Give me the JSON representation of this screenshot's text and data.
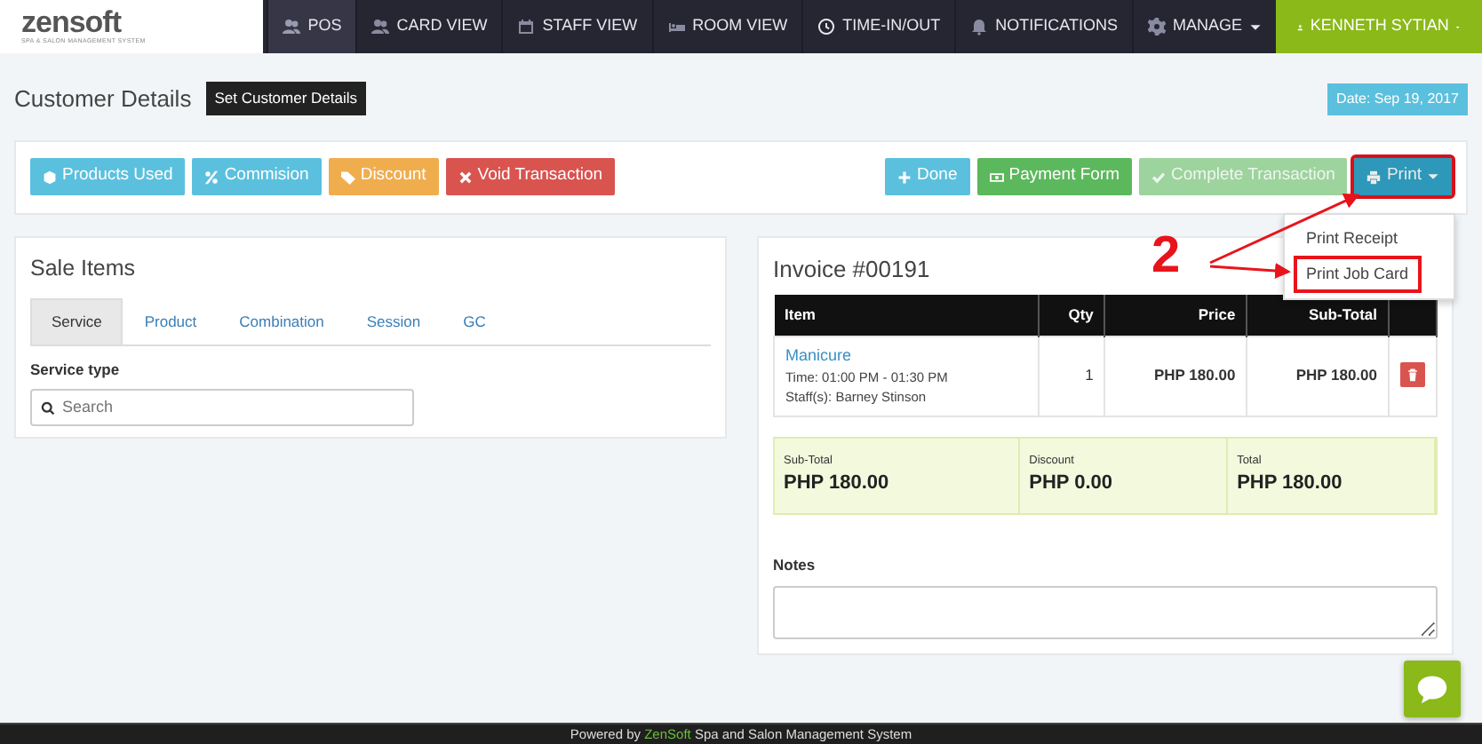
{
  "brand": {
    "name": "zensoft",
    "tagline": "SPA & SALON MANAGEMENT SYSTEM"
  },
  "nav": [
    {
      "label": "POS",
      "selected": true
    },
    {
      "label": "CARD VIEW",
      "selected": false
    },
    {
      "label": "STAFF VIEW",
      "selected": false
    },
    {
      "label": "ROOM VIEW",
      "selected": false
    },
    {
      "label": "TIME-IN/OUT",
      "selected": false
    },
    {
      "label": "NOTIFICATIONS",
      "selected": false
    },
    {
      "label": "MANAGE",
      "selected": false,
      "dropdown": true
    }
  ],
  "user": {
    "label": "KENNETH SYTIAN"
  },
  "page": {
    "title": "Customer Details",
    "action": "Set Customer Details",
    "date": "Date: Sep 19, 2017"
  },
  "left_buttons": [
    {
      "label": "Products Used",
      "color": "#5bc0de"
    },
    {
      "label": "Commision",
      "color": "#5bc0de"
    },
    {
      "label": "Discount",
      "color": "#f0ad4e"
    },
    {
      "label": "Void Transaction",
      "color": "#d9534f"
    }
  ],
  "right_buttons": [
    {
      "label": "Done",
      "color": "#5bc0de",
      "disabled": false
    },
    {
      "label": "Payment Form",
      "color": "#5cb85c",
      "disabled": false
    },
    {
      "label": "Complete Transaction",
      "color": "#9dd39d",
      "disabled": true
    }
  ],
  "print": {
    "label": "Print",
    "highlighted": true,
    "expanded": true,
    "menu": [
      {
        "label": "Print Receipt",
        "highlighted": false
      },
      {
        "label": "Print Job Card",
        "highlighted": true
      }
    ]
  },
  "annotation": {
    "label": "2"
  },
  "sale_items": {
    "title": "Sale Items",
    "tabs": [
      {
        "label": "Service",
        "selected": true
      },
      {
        "label": "Product",
        "selected": false
      },
      {
        "label": "Combination",
        "selected": false
      },
      {
        "label": "Session",
        "selected": false
      },
      {
        "label": "GC",
        "selected": false
      }
    ],
    "field_label": "Service type",
    "search": {
      "placeholder": "Search"
    }
  },
  "invoice": {
    "title": "Invoice #00191",
    "columns": [
      "Item",
      "Qty",
      "Price",
      "Sub-Total"
    ],
    "rows": [
      {
        "item": "Manicure",
        "time": "Time: 01:00 PM - 01:30 PM",
        "staff": "Staff(s): Barney Stinson",
        "qty": "1",
        "price": "PHP 180.00",
        "subtotal": "PHP 180.00"
      }
    ],
    "totals": [
      {
        "label": "Sub-Total",
        "value": "PHP 180.00"
      },
      {
        "label": "Discount",
        "value": "PHP 0.00"
      },
      {
        "label": "Total",
        "value": "PHP 180.00"
      }
    ],
    "notes_label": "Notes"
  },
  "footer": {
    "prefix": "Powered by",
    "brand": "ZenSoft",
    "suffix": "Spa and Salon Management System"
  }
}
